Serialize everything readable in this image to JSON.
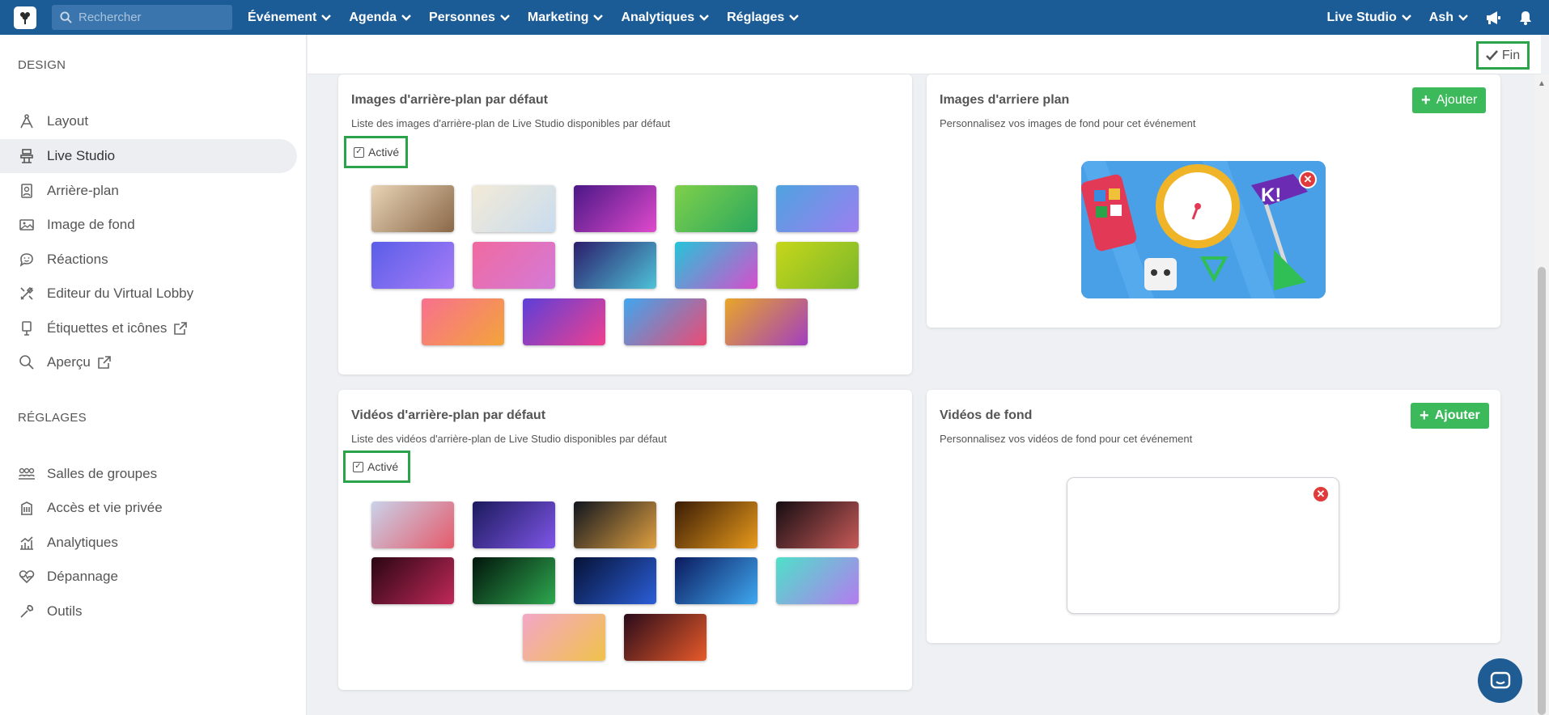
{
  "topbar": {
    "search_placeholder": "Rechercher",
    "menu": [
      "Événement",
      "Agenda",
      "Personnes",
      "Marketing",
      "Analytiques",
      "Réglages"
    ],
    "right_menu": [
      "Live Studio",
      "Ash"
    ]
  },
  "sidebar": {
    "design_heading": "DESIGN",
    "design_items": [
      {
        "label": "Layout",
        "icon": "layout-icon"
      },
      {
        "label": "Live Studio",
        "icon": "live-studio-icon",
        "active": true
      },
      {
        "label": "Arrière-plan",
        "icon": "background-icon"
      },
      {
        "label": "Image de fond",
        "icon": "image-icon"
      },
      {
        "label": "Réactions",
        "icon": "reactions-icon"
      },
      {
        "label": "Editeur du Virtual Lobby",
        "icon": "tools-icon"
      },
      {
        "label": "Étiquettes et icônes",
        "icon": "label-icon",
        "external": true
      },
      {
        "label": "Aperçu",
        "icon": "search-icon",
        "external": true
      }
    ],
    "settings_heading": "RÉGLAGES",
    "settings_items": [
      {
        "label": "Salles de groupes",
        "icon": "groups-icon"
      },
      {
        "label": "Accès et vie privée",
        "icon": "building-icon"
      },
      {
        "label": "Analytiques",
        "icon": "chart-icon"
      },
      {
        "label": "Dépannage",
        "icon": "heartbeat-icon"
      },
      {
        "label": "Outils",
        "icon": "wrench-icon"
      }
    ]
  },
  "header": {
    "done_label": "Fin"
  },
  "default_images": {
    "title": "Images d'arrière-plan par défaut",
    "description": "Liste des images d'arrière-plan de Live Studio disponibles par défaut",
    "toggle_label": "Activé",
    "checked": true,
    "swatches": [
      [
        "#e8d3b6",
        "#8a6848"
      ],
      [
        "#f3ead7",
        "#c8dcef"
      ],
      [
        "#4a1786",
        "#e04acc"
      ],
      [
        "#7fd04a",
        "#2ba85e"
      ],
      [
        "#4fa3e0",
        "#9c7ef0"
      ],
      [
        "#5a5ee8",
        "#a77cf7"
      ],
      [
        "#f06aa0",
        "#d47ad8"
      ],
      [
        "#2b1d6b",
        "#4ec3d8"
      ],
      [
        "#26c4d8",
        "#d64ecc"
      ],
      [
        "#c6d61b",
        "#7ab82a"
      ],
      [
        "#f8708f",
        "#f3a43a"
      ],
      [
        "#5c3fd8",
        "#f0408f"
      ],
      [
        "#3fa6ef",
        "#ec4a73"
      ],
      [
        "#e8a628",
        "#a23fbf"
      ]
    ]
  },
  "custom_images": {
    "title": "Images d'arriere plan",
    "description": "Personnalisez vos images de fond pour cet événement",
    "add_label": "Ajouter"
  },
  "default_videos": {
    "title": "Vidéos d'arrière-plan par défaut",
    "description": "Liste des vidéos d'arrière-plan de Live Studio disponibles par défaut",
    "toggle_label": "Activé",
    "checked": true,
    "swatches": [
      [
        "#c9d2ea",
        "#e55a6a"
      ],
      [
        "#1b1a5c",
        "#7f56e8"
      ],
      [
        "#10151f",
        "#e0a040"
      ],
      [
        "#3a1c05",
        "#e89a1c"
      ],
      [
        "#150d12",
        "#c85a58"
      ],
      [
        "#2a0612",
        "#c0285a"
      ],
      [
        "#02150b",
        "#2ea84f"
      ],
      [
        "#061236",
        "#2b5fd8"
      ],
      [
        "#0b1a5e",
        "#3fa8f0"
      ],
      [
        "#4ee0c8",
        "#b47bf0"
      ],
      [
        "#f3a7c7",
        "#f0c24a"
      ],
      [
        "#2a0b1a",
        "#e85a2a"
      ]
    ]
  },
  "custom_videos": {
    "title": "Vidéos de fond",
    "description": "Personnalisez vos vidéos de fond pour cet événement",
    "add_label": "Ajouter"
  },
  "colors": {
    "topbar": "#1b5b96",
    "accent_green": "#3cb95b",
    "highlight_green": "#2aa34a",
    "danger": "#e03a3a"
  }
}
